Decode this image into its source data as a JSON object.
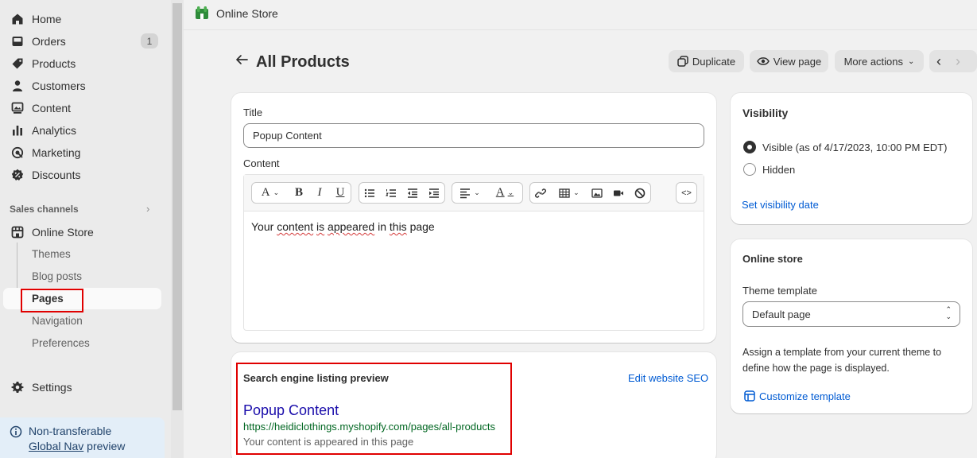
{
  "sidebar": {
    "items": [
      {
        "label": "Home",
        "icon": "home-icon"
      },
      {
        "label": "Orders",
        "icon": "orders-icon",
        "badge": "1"
      },
      {
        "label": "Products",
        "icon": "tag-icon"
      },
      {
        "label": "Customers",
        "icon": "person-icon"
      },
      {
        "label": "Content",
        "icon": "content-icon"
      },
      {
        "label": "Analytics",
        "icon": "bar-chart-icon"
      },
      {
        "label": "Marketing",
        "icon": "target-icon"
      },
      {
        "label": "Discounts",
        "icon": "discount-icon"
      }
    ],
    "sales_channels_label": "Sales channels",
    "channel": {
      "label": "Online Store",
      "icon": "store-icon"
    },
    "sub_items": [
      "Themes",
      "Blog posts",
      "Pages",
      "Navigation",
      "Preferences"
    ],
    "active_sub_item": "Pages",
    "settings_label": "Settings",
    "preview_notice": {
      "line1": "Non-transferable",
      "link": "Global Nav",
      "suffix": " preview"
    }
  },
  "topbar": {
    "store_name": "Online Store"
  },
  "header": {
    "title": "All Products",
    "buttons": {
      "duplicate": "Duplicate",
      "view_page": "View page",
      "more_actions": "More actions"
    }
  },
  "main_card": {
    "title_label": "Title",
    "title_value": "Popup Content",
    "content_label": "Content",
    "content_words": [
      "Your",
      "content",
      "is",
      "appeared",
      "in",
      "this",
      "page"
    ],
    "misspelled": [
      "content",
      "is",
      "appeared",
      "this"
    ]
  },
  "seo_card": {
    "heading": "Search engine listing preview",
    "edit_link": "Edit website SEO",
    "preview_title": "Popup Content",
    "preview_url": "https://heidiclothings.myshopify.com/pages/all-products",
    "preview_desc": "Your content is appeared in this page"
  },
  "visibility_card": {
    "heading": "Visibility",
    "options": [
      "Visible (as of 4/17/2023, 10:00 PM EDT)",
      "Hidden"
    ],
    "selected": "Visible (as of 4/17/2023, 10:00 PM EDT)",
    "set_date_link": "Set visibility date"
  },
  "online_store_card": {
    "heading": "Online store",
    "template_label": "Theme template",
    "template_value": "Default page",
    "description": "Assign a template from your current theme to define how the page is displayed.",
    "customize_link": "Customize template"
  },
  "colors": {
    "accent": "#005bd3",
    "highlight": "#e00000",
    "seo_title": "#1a0dab",
    "seo_url": "#006621"
  }
}
